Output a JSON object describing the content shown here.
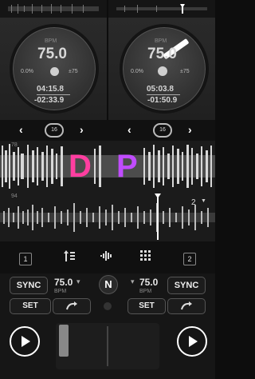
{
  "deck1": {
    "bpm_label": "BPM",
    "bpm": "75.0",
    "pitch": "0.0%",
    "range": "±75",
    "elapsed": "04:15.8",
    "remaining": "-02:33.9",
    "loop_size": "16",
    "beat_marker": "78",
    "beat_marker2": "94",
    "number_badge": "1",
    "sync_label": "SYNC",
    "set_label": "SET",
    "bottom_bpm": "75.0",
    "bottom_bpm_label": "BPM"
  },
  "deck2": {
    "bpm_label": "BPM",
    "bpm": "75.0",
    "pitch": "0.0%",
    "range": "±75",
    "elapsed": "05:03.8",
    "remaining": "-01:50.9",
    "loop_size": "16",
    "beat_marker": "2",
    "number_badge": "2",
    "sync_label": "SYNC",
    "set_label": "SET",
    "bottom_bpm": "75.0",
    "bottom_bpm_label": "BPM"
  },
  "overlay_letters": [
    "D",
    "P"
  ],
  "center_logo": "N",
  "colors": {
    "accent_pink": "#ff3ea0",
    "white": "#ffffff",
    "panel": "#222222"
  }
}
